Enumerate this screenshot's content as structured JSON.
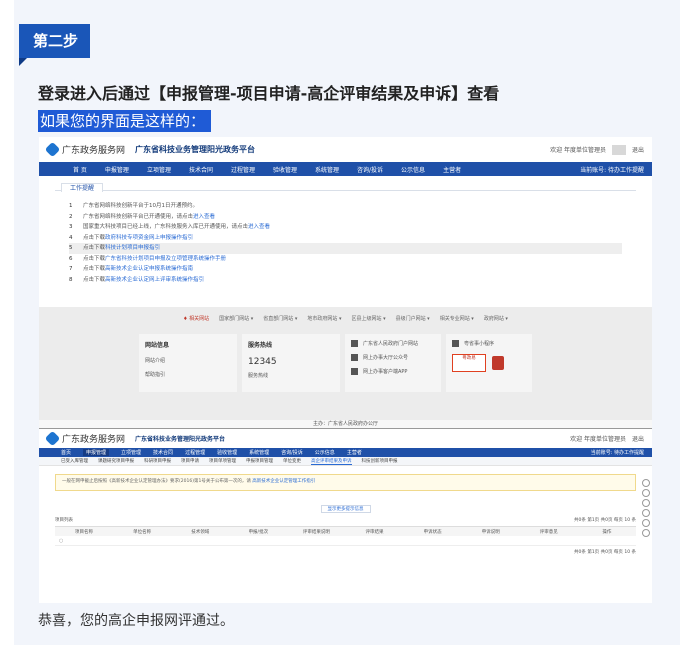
{
  "step_label": "第二步",
  "heading": "登录进入后通过【申报管理-项目申请-高企评审结果及申诉】查看",
  "highlight": "如果您的界面是这样的：",
  "caption": "恭喜，您的高企申报网评通过。",
  "colors": {
    "accent": "#1a56b8",
    "nav": "#1f50a8",
    "highlight_bg": "#1f5bd6"
  },
  "screenshot1": {
    "site_name": "广东政务服务网",
    "platform_name": "广东省科技业务管理阳光政务平台",
    "welcome": "欢迎 年度单位管理员",
    "logout": "退出",
    "nav": [
      "首 页",
      "申报管理",
      "立项管理",
      "技术合同",
      "过程管理",
      "验收管理",
      "系统管理",
      "咨询/投诉",
      "公示信息",
      "主营者"
    ],
    "nav_right": "当前账号: 待办工作提醒",
    "work_tab": "工作提醒",
    "notices": [
      {
        "num": "1",
        "text": "广东省网络科技创新平台于10月1日开通预约。"
      },
      {
        "num": "2",
        "text": "广东省网络科技创新平台已开通使用，请点击",
        "link": "进入查看"
      },
      {
        "num": "3",
        "text": "国家重大科技项目已经上线，广东科技服务入库已开通使用，请点击",
        "link": "进入查看"
      },
      {
        "num": "4",
        "text": "点击下载",
        "link": "政府科技专项资金网上申报操作指引"
      },
      {
        "num": "5",
        "text": "点击下载",
        "link": "科技计划项目申报指引"
      },
      {
        "num": "6",
        "text": "点击下载",
        "link": "广东省科技计划项目申报及立项管理系统操作手册"
      },
      {
        "num": "7",
        "text": "点击下载",
        "link": "高新技术企业认定申报系统操作指南"
      },
      {
        "num": "8",
        "text": "点击下载",
        "link": "高新技术企业认定网上评审系统操作指引"
      }
    ],
    "footer_links": [
      "♦ 相关网站",
      "国家部门网站 ▾",
      "省直部门网站 ▾",
      "地市政府网站 ▾",
      "区县上级网站 ▾",
      "县级门户网站 ▾",
      "相关专业网站 ▾",
      "政府网站 ▾"
    ],
    "panel1": {
      "title": "网站信息",
      "rows": [
        "网站介绍",
        "帮助指引"
      ]
    },
    "panel2": {
      "title": "服务热线",
      "number": "12345",
      "row": "服务热线"
    },
    "panel3": {
      "rows": [
        "广东省人民政府门户网站",
        "网上办事大厅公众号",
        "网上办事客户端APP"
      ]
    },
    "panel4": {
      "title": "粤省事小程序",
      "app": "粤政易"
    },
    "footer_bottom": "主办：广东省人民政府办公厅"
  },
  "screenshot2": {
    "site_name": "广东政务服务网",
    "platform_name": "广东省科技业务管理阳光政务平台",
    "welcome": "欢迎 年度单位管理员",
    "logout": "退出",
    "nav": [
      "首页",
      "申报管理",
      "立项管理",
      "技术合同",
      "过程管理",
      "验收管理",
      "系统管理",
      "咨询/投诉",
      "公示信息",
      "主营者"
    ],
    "active_nav": "申报管理",
    "nav_right": "当前账号: 待办工作提醒",
    "subnav": [
      "已受入库管理",
      "课题研究项目申报",
      "科研项目申报",
      "项目申请",
      "项目单项管理",
      "申报项目管理",
      "单位变更",
      "高企评审结果及申诉",
      "科技创新项目申报"
    ],
    "active_subnav": "高企评审结果及申诉",
    "notice": "一般在网申截止后按照《高新技术企业认定管理办法》要求(2016)第1号关于公布第一次的，请 ",
    "notice_link": "高新技术企业认定管理工作指引",
    "expand": "显示更多提示信息",
    "list_title": "项目列表",
    "pager": "共0条 第1页 共0页 每页 10 条",
    "columns": [
      "项目名称",
      "单位名称",
      "技术领域",
      "申报/批次",
      "评审结果说明",
      "评审结果",
      "申诉状态",
      "申诉说明",
      "评审意见",
      "操作"
    ],
    "empty": "○",
    "pager_bottom": "共0条 第1页 共0页 每页 10 条"
  }
}
